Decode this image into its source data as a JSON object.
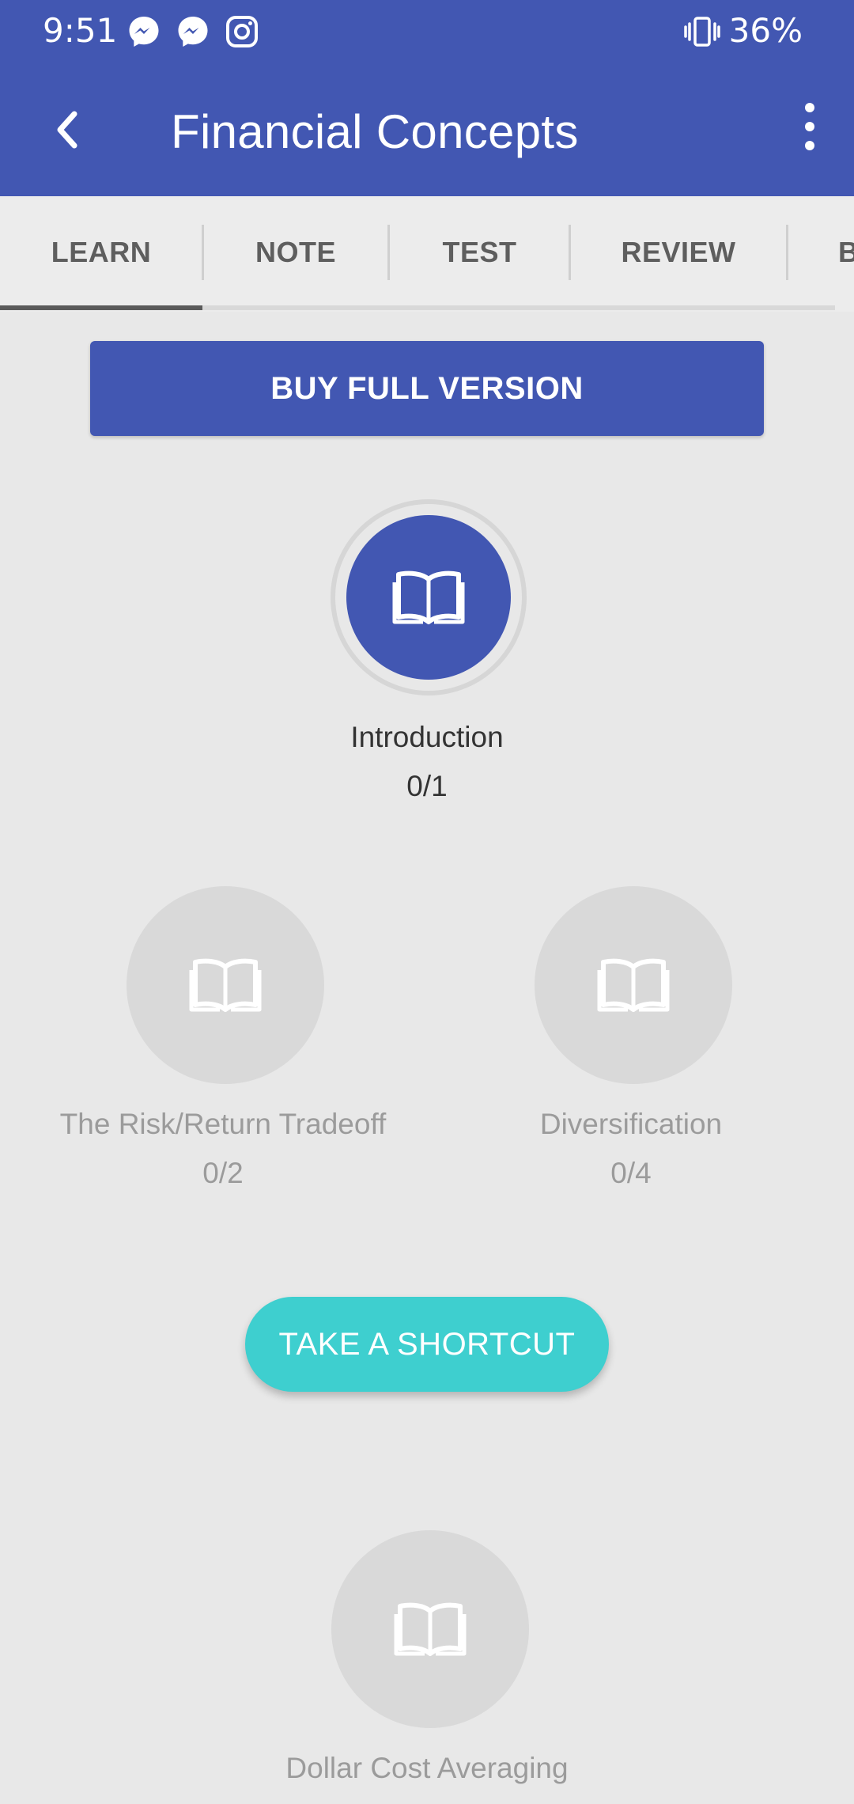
{
  "status_bar": {
    "time": "9:51",
    "notification_icons": [
      "messenger-icon",
      "messenger-icon",
      "instagram-icon"
    ],
    "vibrate_icon": "vibrate-icon",
    "battery": "36%"
  },
  "toolbar": {
    "title": "Financial Concepts",
    "back_icon": "back-arrow-icon",
    "menu_icon": "more-vert-icon"
  },
  "tabs": [
    {
      "label": "LEARN",
      "selected": true
    },
    {
      "label": "NOTE",
      "selected": false
    },
    {
      "label": "TEST",
      "selected": false
    },
    {
      "label": "REVIEW",
      "selected": false
    },
    {
      "label": "B",
      "selected": false
    }
  ],
  "buy_button": "BUY FULL VERSION",
  "lessons": [
    {
      "name": "Introduction",
      "progress": "0/1",
      "active": true,
      "icon": "book-icon"
    },
    {
      "name": "The Risk/Return Tradeoff",
      "progress": "0/2",
      "active": false,
      "icon": "book-icon"
    },
    {
      "name": "Diversification",
      "progress": "0/4",
      "active": false,
      "icon": "book-icon"
    },
    {
      "name": "Dollar Cost Averaging",
      "progress": "",
      "active": false,
      "icon": "book-icon"
    }
  ],
  "shortcut_button": "TAKE A SHORTCUT",
  "colors": {
    "primary": "#4257b2",
    "accent": "#3ecfcf",
    "inactive_circle": "#d9d9d9",
    "background": "#e8e8e8"
  }
}
